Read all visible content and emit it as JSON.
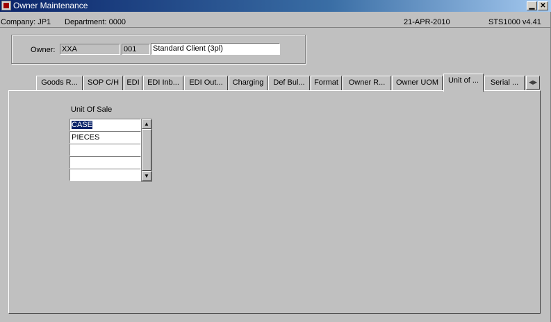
{
  "window": {
    "title": "Owner Maintenance",
    "minimize_glyph": "▁",
    "close_glyph": "✕"
  },
  "status": {
    "company": "Company: JP1",
    "department": "Department: 0000",
    "date": "21-APR-2010",
    "version": "STS1000  v4.41"
  },
  "owner": {
    "label": "Owner:",
    "code": "XXA",
    "number": "001",
    "name": "Standard Client (3pl)"
  },
  "tabs": [
    {
      "label": "Goods R..."
    },
    {
      "label": "SOP C/H"
    },
    {
      "label": "EDI"
    },
    {
      "label": "EDI Inb..."
    },
    {
      "label": "EDI Out..."
    },
    {
      "label": "Charging"
    },
    {
      "label": "Def Bul..."
    },
    {
      "label": "Format"
    },
    {
      "label": "Owner R..."
    },
    {
      "label": "Owner UOM"
    },
    {
      "label": "Unit of ..."
    },
    {
      "label": "Serial ..."
    }
  ],
  "active_tab": "Unit of ...",
  "tab_scroll_glyph": "◀▶",
  "unit_of_sale": {
    "label": "Unit Of Sale",
    "rows": [
      "CASE",
      "PIECES",
      "",
      "",
      ""
    ],
    "selected_row": 0
  },
  "scroll_up_glyph": "▲",
  "scroll_down_glyph": "▼"
}
